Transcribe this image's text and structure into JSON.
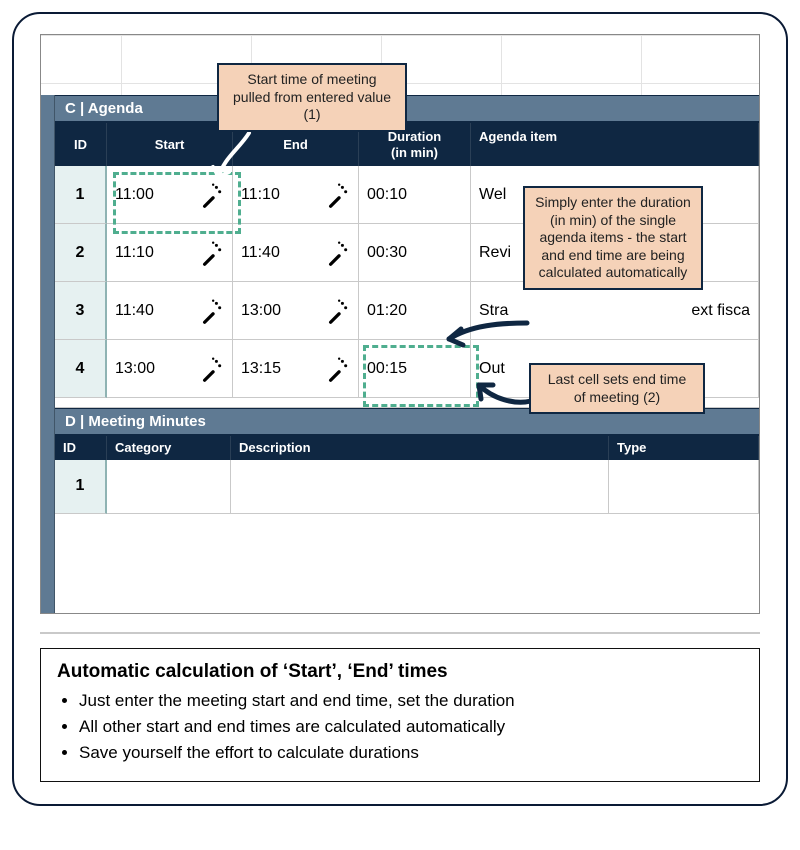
{
  "sections": {
    "agenda_title": "C | Agenda",
    "minutes_title": "D | Meeting Minutes"
  },
  "agenda_headers": {
    "id": "ID",
    "start": "Start",
    "end": "End",
    "duration_l1": "Duration",
    "duration_l2": "(in min)",
    "item": "Agenda item"
  },
  "agenda_rows": [
    {
      "id": "1",
      "start": "11:00",
      "end": "11:10",
      "duration": "00:10",
      "item": "Wel"
    },
    {
      "id": "2",
      "start": "11:10",
      "end": "11:40",
      "duration": "00:30",
      "item": "Revi"
    },
    {
      "id": "3",
      "start": "11:40",
      "end": "13:00",
      "duration": "01:20",
      "item": "Stra",
      "item_suffix": "ext fisca"
    },
    {
      "id": "4",
      "start": "13:00",
      "end": "13:15",
      "duration": "00:15",
      "item": "Out"
    }
  ],
  "minutes_headers": {
    "id": "ID",
    "category": "Category",
    "description": "Description",
    "type": "Type"
  },
  "minutes_rows": [
    {
      "id": "1"
    }
  ],
  "callouts": {
    "top": "Start time of meeting pulled from entered value (1)",
    "right": "Simply enter the duration (in min) of the single agenda items - the start and end time are being calculated automatically",
    "bottom": "Last cell sets end time of meeting (2)"
  },
  "info": {
    "title": "Automatic calculation of ‘Start’, ‘End’ times",
    "bullets": [
      "Just enter the meeting start and end time, set the duration",
      "All other start and end times are calculated automatically",
      "Save yourself the effort to calculate durations"
    ]
  }
}
